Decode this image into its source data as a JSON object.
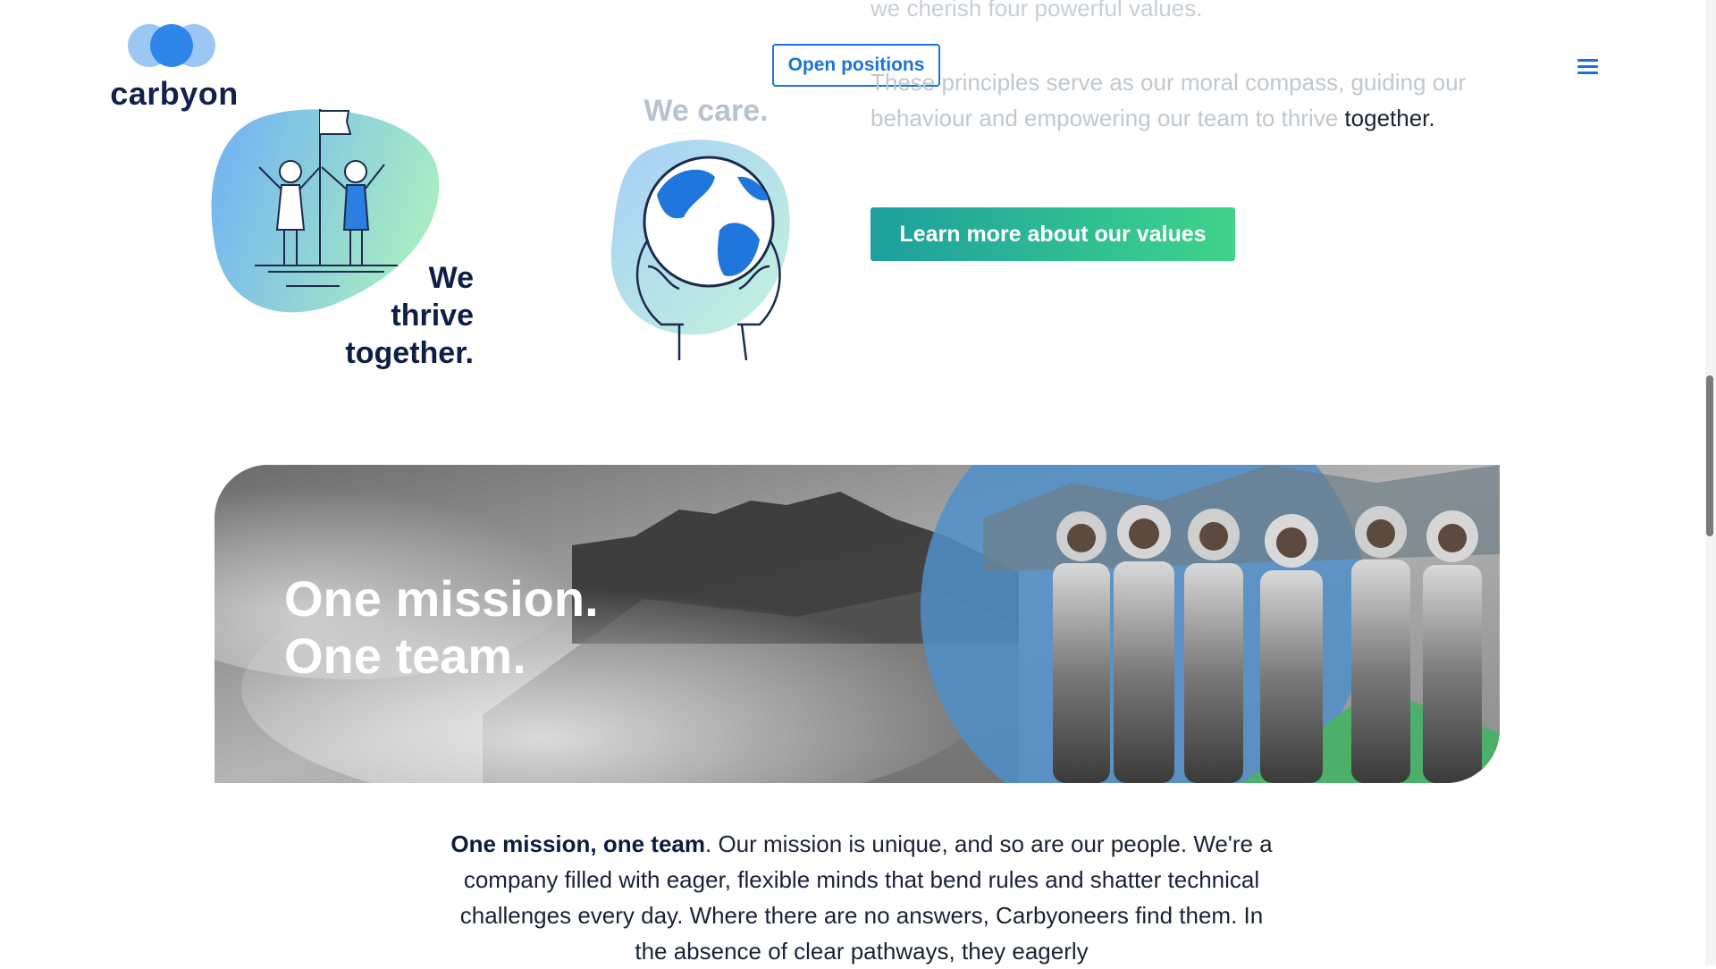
{
  "header": {
    "logo_text": "carbyon",
    "open_positions_label": "Open positions",
    "menu_icon": "hamburger-menu-icon"
  },
  "values": {
    "intro_line": "we cherish four powerful values.",
    "paragraph_faded": "These principles serve as our moral compass, guiding our behaviour and empowering our team to thrive",
    "paragraph_end": "together.",
    "learn_more_label": "Learn more about our values",
    "thrive_line1": "We",
    "thrive_line2": "thrive",
    "thrive_line3": "together.",
    "care_title": "We care."
  },
  "banner": {
    "heading_line1": "One mission.",
    "heading_line2": "One team."
  },
  "mission": {
    "lead_bold": "One mission, one team",
    "body": ". Our mission is unique, and so are our people. We're a company filled with eager, flexible minds that bend rules and shatter technical challenges every day. Where there are no answers, Carbyoneers find them. In the absence of clear pathways, they eagerly"
  },
  "colors": {
    "brand_blue": "#1a73d9",
    "navy": "#13224d",
    "gradient_start": "#1c9f9e",
    "gradient_end": "#3fd48a"
  }
}
